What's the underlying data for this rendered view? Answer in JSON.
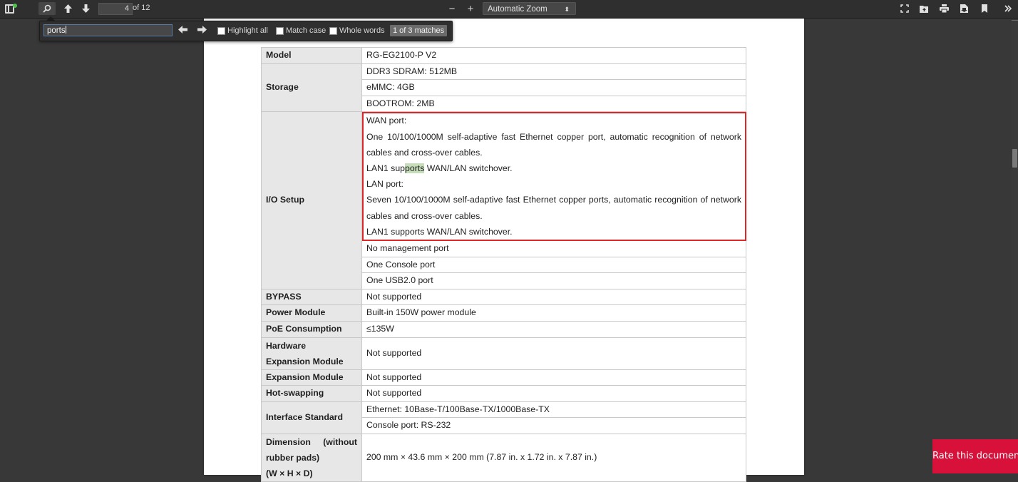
{
  "toolbar": {
    "page_number": "4",
    "page_count": "of 12",
    "zoom_label": "Automatic Zoom",
    "zoom_caret": "⬍",
    "zoom_out": "−",
    "zoom_in": "+",
    "prev_page": "🡅",
    "next_page": "🡇"
  },
  "findbar": {
    "query": "ports",
    "prev": "⬅",
    "next": "➡",
    "highlight_all": "Highlight all",
    "match_case": "Match case",
    "whole_words": "Whole words",
    "match_count": "1 of 3 matches"
  },
  "spec_table": {
    "model_label": "Model",
    "model_value": "RG-EG2100-P V2",
    "storage_label": "Storage",
    "storage": [
      "DDR3 SDRAM: 512MB",
      "eMMC: 4GB",
      "BOOTROM: 2MB"
    ],
    "io_label": "I/O Setup",
    "io_wan_title": "WAN port:",
    "io_wan_desc": "One 10/100/1000M self-adaptive fast Ethernet copper port, automatic recognition of network cables and cross-over cables.",
    "io_wan_lan1_pre": "LAN1 sup",
    "io_wan_lan1_match": "ports",
    "io_wan_lan1_post": " WAN/LAN switchover.",
    "io_lan_title": "LAN port:",
    "io_lan_desc": "Seven 10/100/1000M self-adaptive fast Ethernet copper ports, automatic recognition of network cables and cross-over cables.",
    "io_lan_lan1": "LAN1 supports WAN/LAN switchover.",
    "io_other": [
      "No management port",
      "One Console port",
      "One USB2.0 port"
    ],
    "bypass_label": "BYPASS",
    "bypass_value": "Not supported",
    "power_label": "Power Module",
    "power_value": "Built-in 150W power module",
    "poe_label": "PoE Consumption",
    "poe_value": "≤135W",
    "hw_exp_label_1": "Hardware",
    "hw_exp_label_2": "Expansion Module",
    "hw_exp_value": "Not supported",
    "exp_label": "Expansion Module",
    "exp_value": "Not supported",
    "hot_label": "Hot-swapping",
    "hot_value": "Not supported",
    "iface_label": "Interface Standard",
    "iface": [
      "Ethernet: 10Base-T/100Base-TX/1000Base-TX",
      "Console port: RS-232"
    ],
    "dim_label_1": "Dimension (without",
    "dim_label_2": "rubber pads)",
    "dim_label_3": "(W × H × D)",
    "dim_value": "200 mm × 43.6 mm × 200 mm (7.87 in. x 1.72 in. x 7.87 in.)"
  },
  "rate_button": "Rate this document"
}
